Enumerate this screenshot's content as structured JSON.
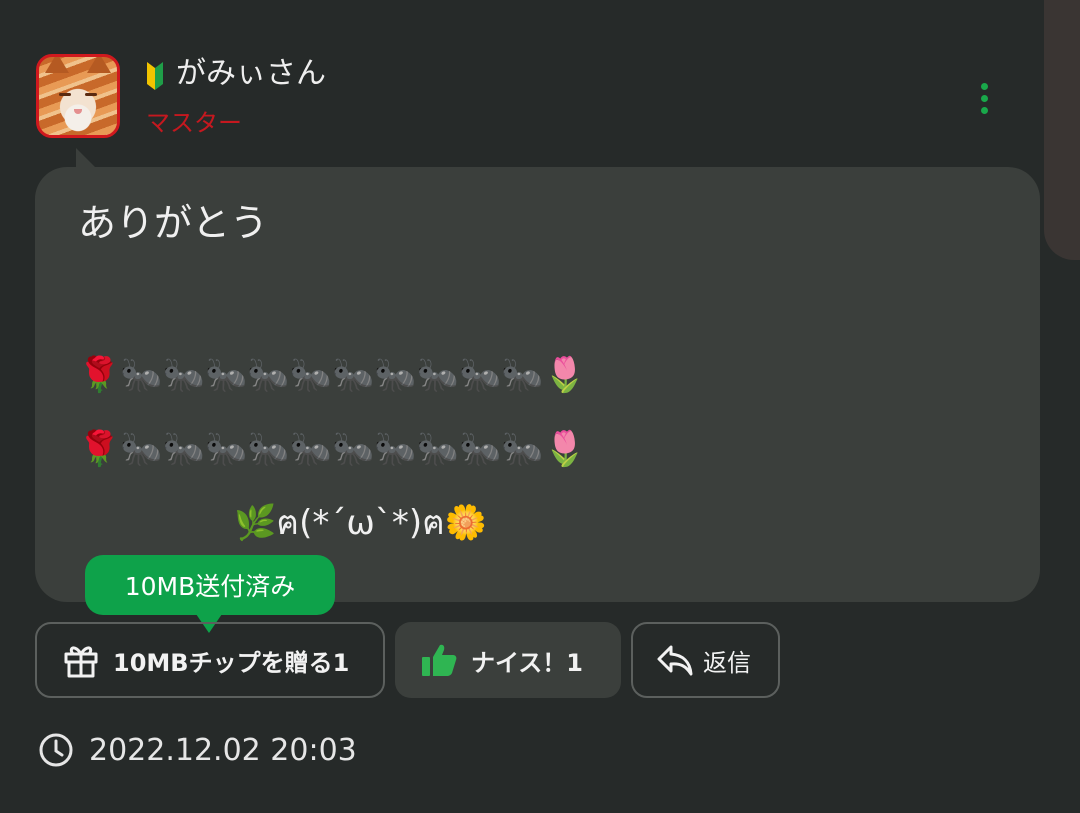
{
  "post": {
    "user_name": "がみぃさん",
    "user_rank": "マスター",
    "avatar_icon": "cat-photo-avatar",
    "badge_icon": "beginner-mark-icon",
    "menu_icon": "more-vertical-icon",
    "message_lines": [
      "ありがとう",
      "🌹🐜🐜🐜🐜🐜🐜🐜🐜🐜🐜🌷",
      "🌹🐜🐜🐜🐜🐜🐜🐜🐜🐜🐜🌷",
      "🌿ฅ(*´ω`*)ฅ🌼"
    ],
    "sent_tooltip": "10MB送付済み",
    "tip_button": "10MBチップを贈る1",
    "nice_button": "ナイス！1",
    "reply_button": "返信",
    "timestamp": "2022.12.02 20:03"
  },
  "colors": {
    "background": "#262a29",
    "bubble": "#3b3f3c",
    "accent_green": "#0ea24a",
    "rank_red": "#c5181f"
  }
}
